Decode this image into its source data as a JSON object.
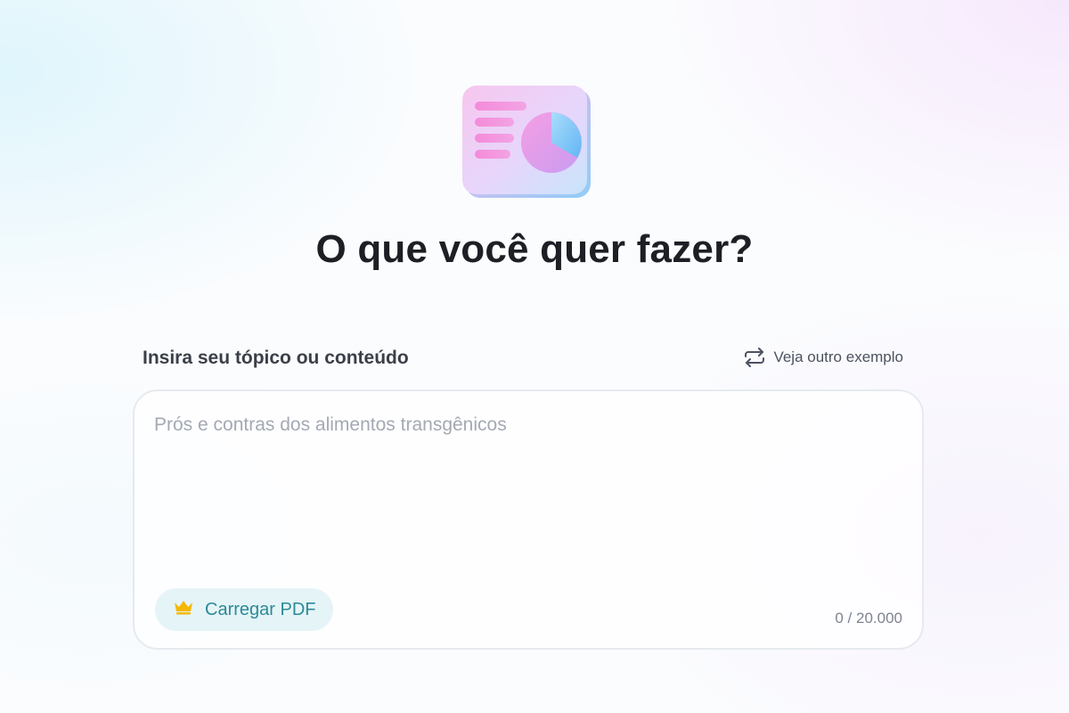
{
  "header": {
    "illustration_icon": "presentation-chart-icon",
    "title": "O que você quer fazer?"
  },
  "input_section": {
    "label": "Insira seu tópico ou conteúdo",
    "example_link": {
      "icon": "repeat-arrows-icon",
      "label": "Veja outro exemplo"
    },
    "textarea": {
      "value": "",
      "placeholder": "Prós e contras dos alimentos transgênicos"
    },
    "upload_button": {
      "icon": "crown-icon",
      "label": "Carregar PDF"
    },
    "char_counter": "0 / 20.000"
  },
  "colors": {
    "accent_teal": "#2b8a97",
    "upload_bg": "#e5f4f7",
    "crown_gold": "#f5b800",
    "title_text": "#1c1f24"
  }
}
